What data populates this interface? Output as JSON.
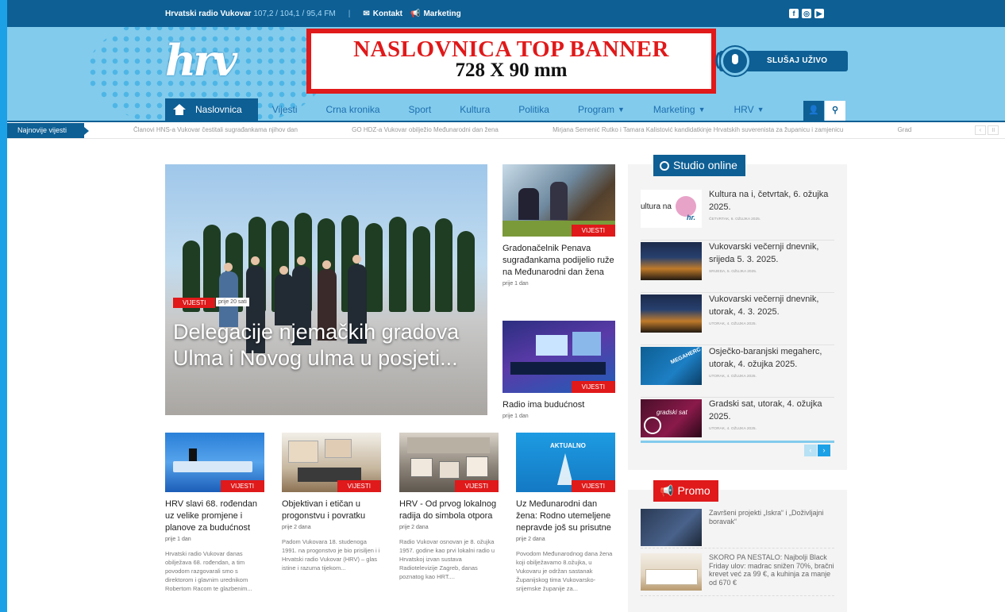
{
  "topbar": {
    "station": "Hrvatski radio Vukovar",
    "frequencies": "107,2 / 104,1 / 95,4 FM",
    "separator": "|",
    "contact": "Kontakt",
    "marketing": "Marketing",
    "social": [
      "facebook-icon",
      "instagram-icon",
      "youtube-icon"
    ]
  },
  "header": {
    "logo_text": "hrv",
    "banner_line1": "NASLOVNICA TOP BANNER",
    "banner_line2": "728 X 90 mm",
    "live_button": "SLUŠAJ UŽIVO"
  },
  "nav": {
    "items": [
      {
        "label": "Naslovnica",
        "active": true
      },
      {
        "label": "Vijesti"
      },
      {
        "label": "Crna kronika"
      },
      {
        "label": "Sport"
      },
      {
        "label": "Kultura"
      },
      {
        "label": "Politika"
      },
      {
        "label": "Program",
        "dropdown": true
      },
      {
        "label": "Marketing",
        "dropdown": true
      },
      {
        "label": "HRV",
        "dropdown": true
      }
    ]
  },
  "ticker": {
    "label": "Najnovije vijesti",
    "items": [
      "Članovi HNS-a Vukovar čestitali sugrađankama njihov dan",
      "GO HDZ-a Vukovar obilježio Međunarodni dan žena",
      "Mirjana Semenić Rutko i Tamara Kalistović kandidatkinje Hrvatskih suverenista za županicu i zamjenicu",
      "Grad"
    ]
  },
  "hero": {
    "category": "VIJESTI",
    "time": "prije 20 sati",
    "title": "Delegacije njemačkih gradova Ulma i Novog ulma u posjeti..."
  },
  "side_stories": [
    {
      "category": "VIJESTI",
      "title": "Gradonačelnik Penava sugrađankama podijelio ruže na Međunarodni dan žena",
      "time": "prije 1 dan"
    },
    {
      "category": "VIJESTI",
      "title": "Radio ima budućnost",
      "time": "prije 1 dan"
    }
  ],
  "cards": [
    {
      "category": "VIJESTI",
      "title": "HRV slavi 68. rođendan uz velike promjene i planove za budućnost",
      "time": "prije 1 dan",
      "excerpt": "Hrvatski radio Vukovar danas obilježava 68. rođendan, a tim povodom razgovarali smo s direktorom i glavnim urednikom Robertom Racom te glazbenim..."
    },
    {
      "category": "VIJESTI",
      "title": "Objektivan i etičan u progonstvu i povratku",
      "time": "prije 2 dana",
      "excerpt": "Padom Vukovara 18. studenoga 1991. na progonstvo je bio prisiljen i i Hrvatski radio Vukovar (HRV) – glas istine i razuma tijekom..."
    },
    {
      "category": "VIJESTI",
      "title": "HRV - Od prvog lokalnog radija do simbola otpora",
      "time": "prije 2 dana",
      "excerpt": "Radio Vukovar osnovan je 8. ožujka 1957. godine kao prvi lokalni radio u Hrvatskoj izvan sustava Radiotelevizije Zagreb, danas poznatog kao HRT...."
    },
    {
      "category": "VIJESTI",
      "title": "Uz Međunarodni dan žena: Rodno utemeljene nepravde još su prisutne",
      "time": "prije 2 dana",
      "excerpt": "Povodom Međunarodnog dana žena koji obilježavamo 8.ožujka, u Vukovaru je održan sastanak Županijskog tima Vukovarsko-srijemske županije za..."
    }
  ],
  "studio": {
    "title": "Studio online",
    "items": [
      {
        "title": "Kultura na i, četvrtak, 6. ožujka 2025.",
        "date": "ČETVRTAK, 6. OŽUJKA 2025."
      },
      {
        "title": "Vukovarski večernji dnevnik, srijeda 5. 3. 2025.",
        "date": "SRIJEDA, 5. OŽUJKA 2025."
      },
      {
        "title": "Vukovarski večernji dnevnik, utorak, 4. 3. 2025.",
        "date": "UTORAK, 4. OŽUJKA 2025."
      },
      {
        "title": "Osječko-baranjski megaherc, utorak, 4. ožujka 2025.",
        "date": "UTORAK, 4. OŽUJKA 2025."
      },
      {
        "title": "Gradski sat, utorak, 4. ožujka 2025.",
        "date": "UTORAK, 4. OŽUJKA 2025."
      }
    ],
    "thumb_texts": [
      "ultura na",
      "hr.",
      "MEGAHERC",
      "gradski sat"
    ],
    "prev": "‹",
    "next": "›"
  },
  "promo": {
    "title": "Promo",
    "items": [
      {
        "title": "Završeni projekti „Iskra“ i „Doživljajni boravak“"
      },
      {
        "title": "SKORO PA NESTALO: Najbolji Black Friday ulov: madrac snižen 70%, bračni krevet već za 99 €, a kuhinja za manje od 670 €"
      }
    ]
  },
  "colors": {
    "brand_blue": "#0d5f94",
    "header_bg": "#82cbec",
    "accent_red": "#e0191a"
  }
}
